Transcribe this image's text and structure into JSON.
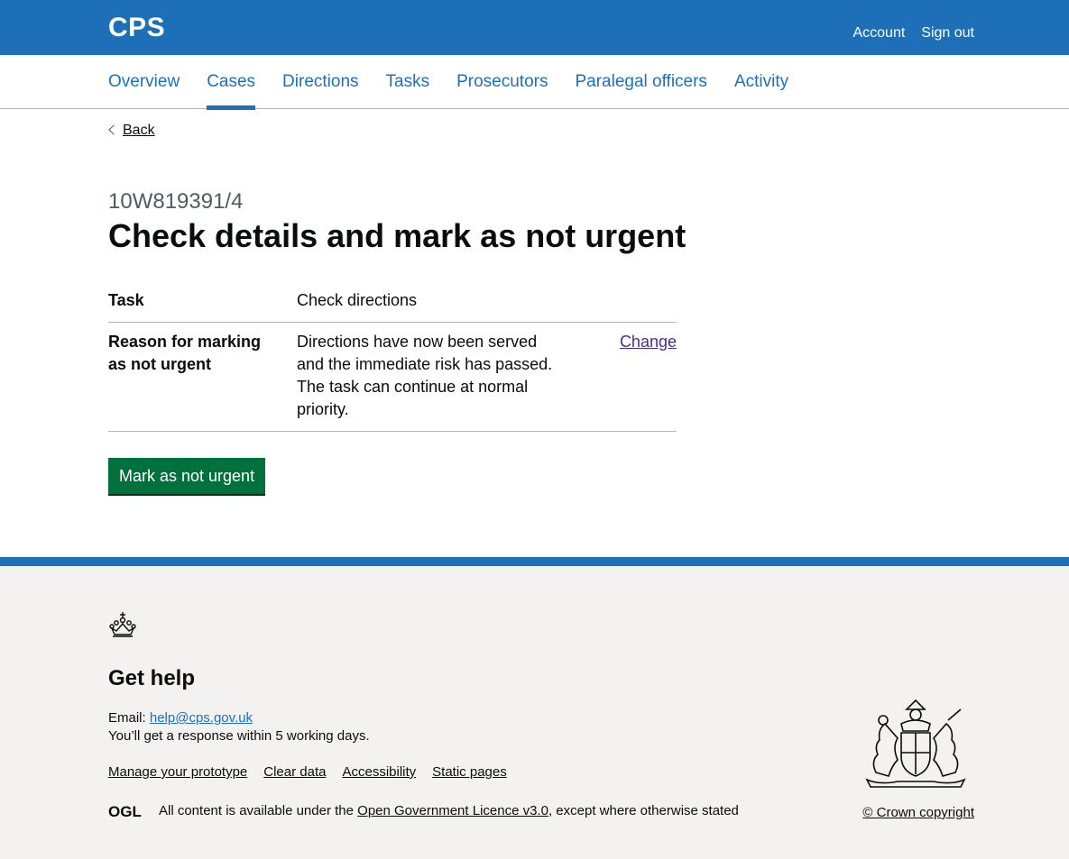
{
  "header": {
    "brand": "CPS",
    "links": [
      "Account",
      "Sign out"
    ]
  },
  "subnav": {
    "items": [
      "Overview",
      "Cases",
      "Directions",
      "Tasks",
      "Prosecutors",
      "Paralegal officers",
      "Activity"
    ],
    "active": "Cases"
  },
  "back_link": "Back",
  "page": {
    "caption": "10W819391/4",
    "title": "Check details and mark as not urgent"
  },
  "summary": {
    "rows": [
      {
        "key": "Task",
        "value": "Check directions",
        "action": ""
      },
      {
        "key": "Reason for marking as not urgent",
        "value": "Directions have now been served and the immediate risk has passed. The task can continue at normal priority.",
        "action": "Change"
      }
    ]
  },
  "button": "Mark as not urgent",
  "footer": {
    "help_title": "Get help",
    "email_label": "Email:",
    "email": "help@cps.gov.uk",
    "response": "You’ll get a response within 5 working days.",
    "links": [
      "Manage your prototype",
      "Clear data",
      "Accessibility",
      "Static pages"
    ],
    "ogl_text": "OGL",
    "licence_prefix": "All content is available under the",
    "licence_link": "Open Government Licence v3.0",
    "licence_suffix": ", except where otherwise stated",
    "copyright": "© Crown copyright"
  },
  "colors": {
    "brand_blue": "#1d70b8",
    "button_green": "#00703c",
    "visited_purple": "#4c2c92",
    "footer_bg": "#f3f2f1"
  }
}
